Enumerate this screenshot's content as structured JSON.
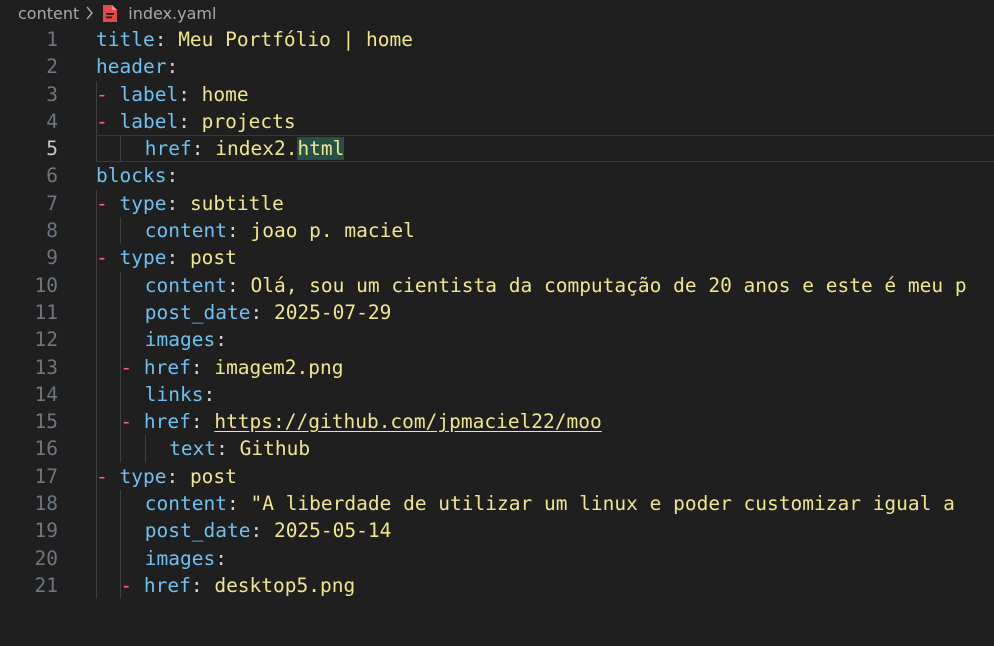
{
  "breadcrumb": {
    "folder": "content",
    "file": "index.yaml",
    "folder_sep_icon": "chevron-right-icon",
    "file_icon": "yaml-file-icon"
  },
  "editor": {
    "current_line": 5,
    "lines": [
      {
        "n": "1",
        "indent": 0,
        "dash": "",
        "key": "title",
        "sep": ": ",
        "value": "Meu Portfólio | home"
      },
      {
        "n": "2",
        "indent": 0,
        "dash": "",
        "key": "header",
        "sep": ":",
        "value": ""
      },
      {
        "n": "3",
        "indent": 1,
        "dash": "- ",
        "key": "label",
        "sep": ": ",
        "value": "home"
      },
      {
        "n": "4",
        "indent": 1,
        "dash": "- ",
        "key": "label",
        "sep": ": ",
        "value": "projects"
      },
      {
        "n": "5",
        "indent": 2,
        "dash": "",
        "key": "href",
        "sep": ": ",
        "value": "index2.",
        "value_highlight": "html"
      },
      {
        "n": "6",
        "indent": 0,
        "dash": "",
        "key": "blocks",
        "sep": ":",
        "value": ""
      },
      {
        "n": "7",
        "indent": 1,
        "dash": "- ",
        "key": "type",
        "sep": ": ",
        "value": "subtitle"
      },
      {
        "n": "8",
        "indent": 2,
        "dash": "",
        "key": "content",
        "sep": ": ",
        "value": "joao p. maciel"
      },
      {
        "n": "9",
        "indent": 1,
        "dash": "- ",
        "key": "type",
        "sep": ": ",
        "value": "post"
      },
      {
        "n": "10",
        "indent": 2,
        "dash": "",
        "key": "content",
        "sep": ": ",
        "value": "Olá, sou um cientista da computação de 20 anos e este é meu p"
      },
      {
        "n": "11",
        "indent": 2,
        "dash": "",
        "key": "post_date",
        "sep": ": ",
        "value": "2025-07-29"
      },
      {
        "n": "12",
        "indent": 2,
        "dash": "",
        "key": "images",
        "sep": ":",
        "value": ""
      },
      {
        "n": "13",
        "indent": 2,
        "dash": "- ",
        "key": "href",
        "sep": ": ",
        "value": "imagem2.png"
      },
      {
        "n": "14",
        "indent": 2,
        "dash": "",
        "key": "links",
        "sep": ":",
        "value": ""
      },
      {
        "n": "15",
        "indent": 2,
        "dash": "- ",
        "key": "href",
        "sep": ": ",
        "value": "https://github.com/jpmaciel22/moo",
        "is_link": true
      },
      {
        "n": "16",
        "indent": 3,
        "dash": "",
        "key": "text",
        "sep": ": ",
        "value": "Github"
      },
      {
        "n": "17",
        "indent": 1,
        "dash": "- ",
        "key": "type",
        "sep": ": ",
        "value": "post"
      },
      {
        "n": "18",
        "indent": 2,
        "dash": "",
        "key": "content",
        "sep": ": ",
        "value": "\"A liberdade de utilizar um linux e poder customizar igual a "
      },
      {
        "n": "19",
        "indent": 2,
        "dash": "",
        "key": "post_date",
        "sep": ": ",
        "value": "2025-05-14"
      },
      {
        "n": "20",
        "indent": 2,
        "dash": "",
        "key": "images",
        "sep": ":",
        "value": ""
      },
      {
        "n": "21",
        "indent": 2,
        "dash": "- ",
        "key": "href",
        "sep": ": ",
        "value": "desktop5.png"
      }
    ]
  },
  "colors": {
    "background": "#1f1f1f",
    "key": "#6fc0f0",
    "string": "#f0e68c",
    "dash": "#ff5c8a",
    "line_number": "#6e7681"
  }
}
